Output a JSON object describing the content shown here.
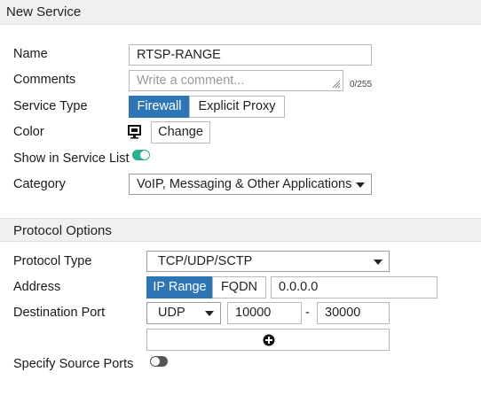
{
  "header": {
    "title": "New Service"
  },
  "form": {
    "name": {
      "label": "Name",
      "value": "RTSP-RANGE"
    },
    "comments": {
      "label": "Comments",
      "placeholder": "Write a comment...",
      "counter": "0/255"
    },
    "service_type": {
      "label": "Service Type",
      "options": [
        "Firewall",
        "Explicit Proxy"
      ],
      "selected": "Firewall"
    },
    "color": {
      "label": "Color",
      "icon": "monitor-icon",
      "button": "Change"
    },
    "show_in_list": {
      "label": "Show in Service List",
      "enabled": true
    },
    "category": {
      "label": "Category",
      "value": "VoIP, Messaging & Other Applications"
    }
  },
  "protocol": {
    "section_title": "Protocol Options",
    "protocol_type": {
      "label": "Protocol Type",
      "value": "TCP/UDP/SCTP"
    },
    "address": {
      "label": "Address",
      "options": [
        "IP Range",
        "FQDN"
      ],
      "selected": "IP Range",
      "value": "0.0.0.0"
    },
    "destination_port": {
      "label": "Destination Port",
      "protocol": "UDP",
      "low": "10000",
      "separator": "-",
      "high": "30000"
    },
    "add_icon": "plus-circle-icon",
    "source_ports": {
      "label": "Specify Source Ports",
      "enabled": false
    }
  },
  "colors": {
    "accent": "#2e75b6",
    "toggle_on": "#2bb08f",
    "toggle_off": "#555555",
    "header_bg": "#f0f0f0"
  }
}
